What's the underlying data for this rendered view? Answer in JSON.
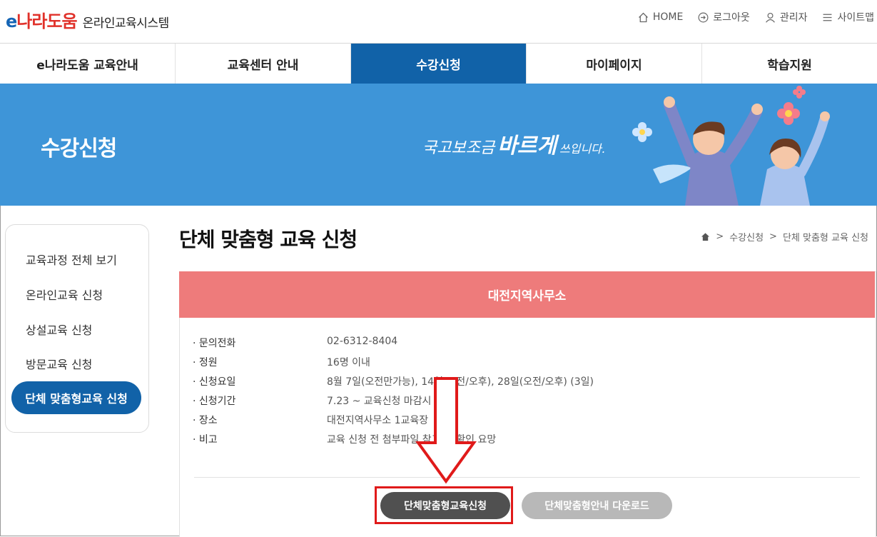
{
  "header": {
    "brand_e": "e",
    "brand_rest": "나라도움",
    "system_name": "온라인교육시스템",
    "util": {
      "home": "HOME",
      "logout": "로그아웃",
      "admin": "관리자",
      "sitemap": "사이트맵"
    }
  },
  "gnb": [
    {
      "label": "e나라도움 교육안내"
    },
    {
      "label": "교육센터 안내"
    },
    {
      "label": "수강신청"
    },
    {
      "label": "마이페이지"
    },
    {
      "label": "학습지원"
    }
  ],
  "banner": {
    "title": "수강신청",
    "slogan_1": "국고보조금",
    "slogan_2": "바르게",
    "slogan_3": "쓰입니다."
  },
  "sidebar": {
    "items": [
      {
        "label": "교육과정 전체 보기"
      },
      {
        "label": "온라인교육 신청"
      },
      {
        "label": "상설교육 신청"
      },
      {
        "label": "방문교육 신청"
      },
      {
        "label": "단체 맞춤형교육 신청"
      }
    ]
  },
  "page": {
    "title": "단체 맞춤형 교육 신청",
    "breadcrumb": [
      "수강신청",
      "단체 맞춤형 교육 신청"
    ]
  },
  "office": {
    "name": "대전지역사무소",
    "rows": [
      {
        "label": "· 문의전화",
        "value": "02-6312-8404"
      },
      {
        "label": "· 정원",
        "value": "16명 이내"
      },
      {
        "label": "· 신청요일",
        "value": "8월 7일(오전만가능), 14일(오전/오후), 28일(오전/오후) (3일)"
      },
      {
        "label": "· 신청기간",
        "value": "7.23 ~ 교육신청 마감시"
      },
      {
        "label": "· 장소",
        "value": "대전지역사무소 1교육장"
      },
      {
        "label": "· 비고",
        "value": "교육 신청 전 첨부파일 참고 후 확인 요망"
      }
    ]
  },
  "buttons": {
    "apply": "단체맞춤형교육신청",
    "download": "단체맞춤형안내 다운로드"
  },
  "colors": {
    "primary": "#1162a8",
    "banner": "#3e95d8",
    "office_bar": "#ee7b7b",
    "highlight": "#e01a1a"
  }
}
